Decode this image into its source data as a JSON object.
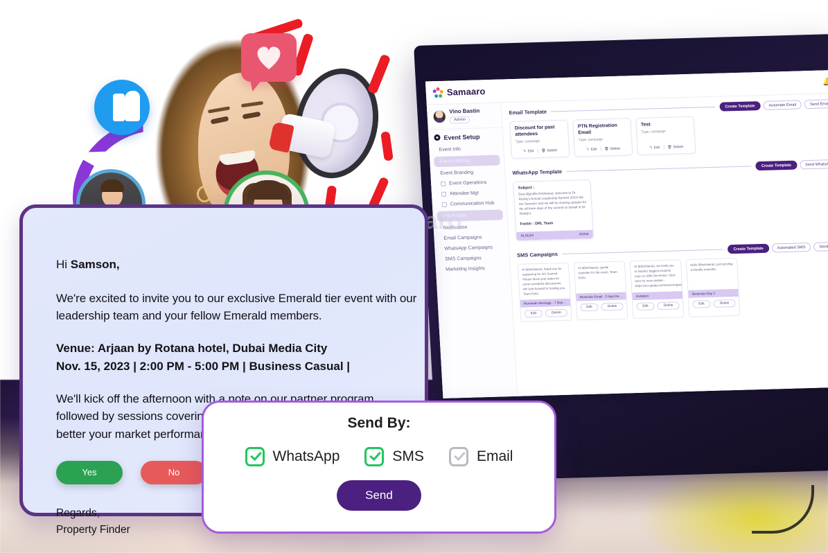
{
  "email": {
    "greeting_prefix": "Hi ",
    "greeting_name": "Samson,",
    "intro": "We're excited to invite you to our exclusive Emerald tier event with our leadership team and your fellow Emerald members.",
    "venue_line": "Venue: Arjaan by Rotana hotel, Dubai Media City",
    "datetime_line": "Nov. 15, 2023 | 2:00 PM - 5:00 PM | Business Casual |",
    "details": "We'll kick off the afternoon with a note on our partner program, followed by sessions covering insights and data that will help you better your market performance.",
    "yes_label": "Yes",
    "no_label": "No",
    "sign_off": "Regards,",
    "sign_name": "Property Finder",
    "yes_color": "#2ba152",
    "no_color": "#e8595a",
    "border_color": "#5c3385"
  },
  "modal": {
    "title": "Send By:",
    "options": [
      {
        "label": "WhatsApp",
        "checked": true
      },
      {
        "label": "SMS",
        "checked": true
      },
      {
        "label": "Email",
        "checked": false
      }
    ],
    "send_label": "Send",
    "accent_color": "#4b2080",
    "checked_color": "#22c55e",
    "border_color": "#a55bdf"
  },
  "dashboard": {
    "brand": "Samaaro",
    "bell_icon": "bell-icon",
    "user": {
      "name": "Vino Bastin",
      "role": "Admin"
    },
    "section_title": "Event Setup",
    "nav": [
      {
        "label": "Event Info",
        "active": false
      },
      {
        "label": "Event Hosting",
        "active": true
      },
      {
        "label": "Event Branding",
        "active": false
      },
      {
        "label": "Event Operations",
        "active": false
      },
      {
        "label": "Attendee Mgt",
        "active": false
      },
      {
        "label": "Communication Hub",
        "active": false
      },
      {
        "label": "List Builder",
        "active": true
      },
      {
        "label": "Notification",
        "active": false
      },
      {
        "label": "Email Campaigns",
        "active": false
      },
      {
        "label": "WhatsApp Campaigns",
        "active": false
      },
      {
        "label": "SMS Campaigns",
        "active": false
      },
      {
        "label": "Marketing Insights",
        "active": false
      }
    ],
    "email_section": {
      "title": "Email Template",
      "buttons": [
        "Create Template",
        "Automate Email",
        "Send Email"
      ],
      "cards": [
        {
          "title": "Discount for past attendees",
          "subtitle": "Type: campaign",
          "edit": "Edit",
          "delete": "Delete"
        },
        {
          "title": "PTN Registration Email",
          "subtitle": "Type: campaign",
          "edit": "Edit",
          "delete": "Delete"
        },
        {
          "title": "Test",
          "subtitle": "Type: campaign",
          "edit": "Edit",
          "delete": "Delete"
        }
      ]
    },
    "whatsapp_section": {
      "title": "WhatsApp Template",
      "buttons": [
        "Create Template",
        "Send WhatsApp"
      ],
      "card": {
        "subject_label": "Subject :",
        "body": "Dear ${profile.firstName}, welcome to Dr. Reddy's Annual Leadership Summit 2023! We are Samaaro and we will be sharing updates for the all three days of the summit on behalf of Dr. Reddy's.",
        "footer": "Footer : DRL Team",
        "tag": "ALSUtril",
        "status": "Active"
      }
    },
    "sms_section": {
      "title": "SMS Campaigns",
      "buttons": [
        "Create Template",
        "Automated SMS",
        "Send SMS"
      ],
      "cards": [
        {
          "body": "Hi ${firstName}, thank you for registering for GX Summit. Please block your dates for some wonderful discussions. We look forward to hosting you. Team Exito.",
          "tag": "Reminder Message - 7 Days befo...",
          "edit": "Edit",
          "delete": "Delete"
        },
        {
          "body": "Hi ${firstName}, gentle reminder for the event. Team Exito.",
          "tag": "Reminder Email - 2 days before D...",
          "edit": "Edit",
          "delete": "Delete"
        },
        {
          "body": "Hi ${firstName}, we invite you to Gujrat's biggest property expo on 28th December. Click here for more details - https://vv.capday.com/users/register",
          "tag": "Invitation",
          "edit": "Edit",
          "delete": "Delete"
        },
        {
          "body": "Hello ${firstName}, just sending a friendly reminder.",
          "tag": "Reminder Day 2",
          "edit": "Edit",
          "delete": "Delete"
        }
      ]
    }
  },
  "decor": {
    "thumbs_up_icon": "thumbs-up-icon",
    "heart_bubble_icon": "heart-speech-bubble-icon",
    "share_icon": "share-icon",
    "megaphone_icon": "megaphone-icon",
    "watermark": "Samaaro"
  }
}
